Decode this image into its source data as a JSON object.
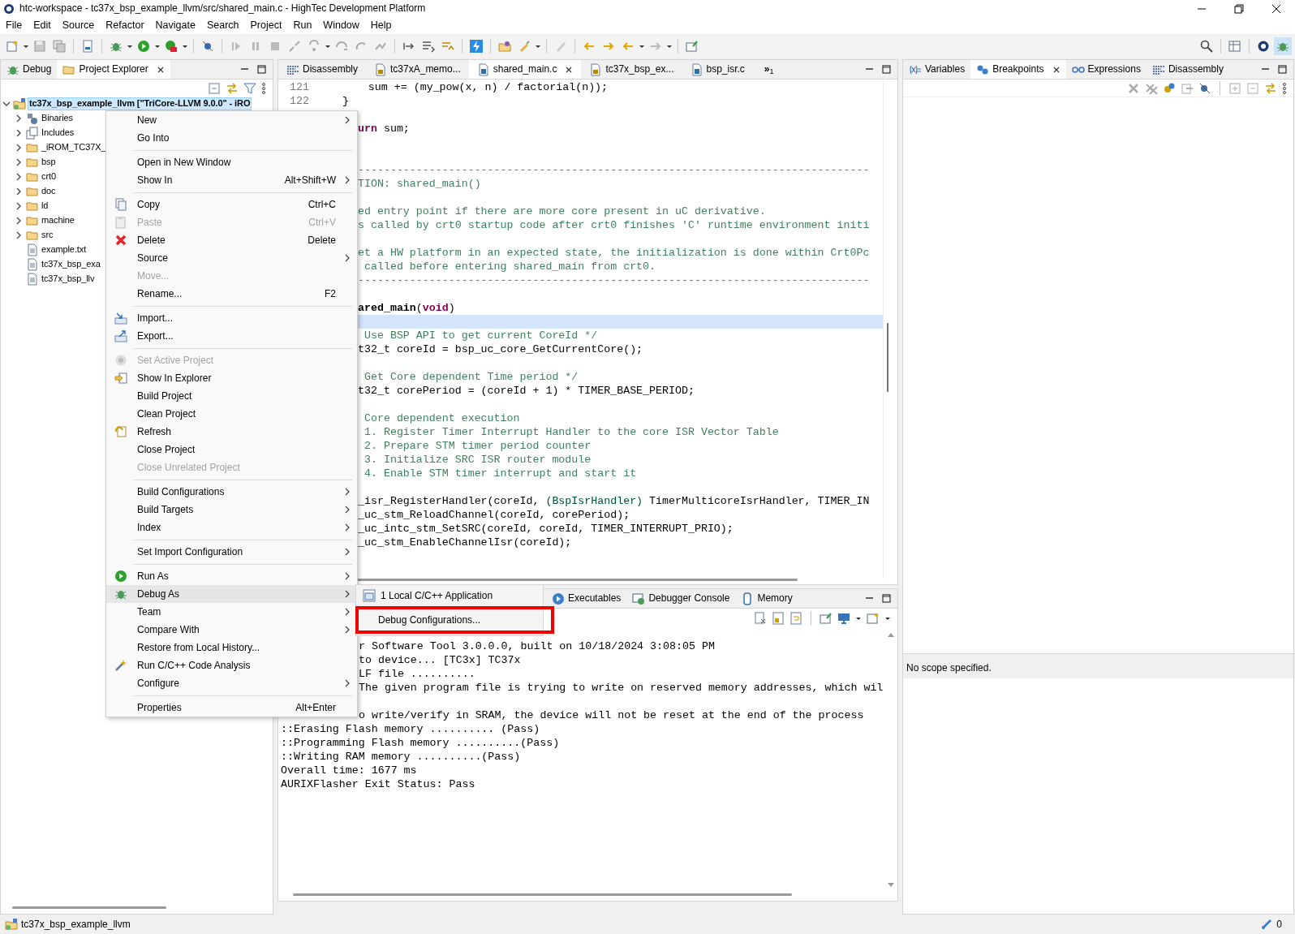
{
  "window": {
    "title": "htc-workspace - tc37x_bsp_example_llvm/src/shared_main.c - HighTec Development Platform"
  },
  "menu_bar": [
    "File",
    "Edit",
    "Source",
    "Refactor",
    "Navigate",
    "Search",
    "Project",
    "Run",
    "Window",
    "Help"
  ],
  "left_panel": {
    "tabs": [
      {
        "label": "Debug",
        "selected": false,
        "closable": false
      },
      {
        "label": "Project Explorer",
        "selected": true,
        "closable": true
      }
    ],
    "tree": [
      {
        "label": "tc37x_bsp_example_llvm [\"TriCore-LLVM 9.0.0\" - iRO",
        "kind": "project",
        "expanded": true,
        "selected": true,
        "children": [
          {
            "label": "Binaries",
            "kind": "binaries",
            "expanded": false,
            "selected": false
          },
          {
            "label": "Includes",
            "kind": "includes",
            "expanded": false,
            "selected": false
          },
          {
            "label": "_iROM_TC37X_",
            "kind": "folder",
            "expanded": false,
            "selected": false
          },
          {
            "label": "bsp",
            "kind": "folder",
            "expanded": false,
            "selected": false
          },
          {
            "label": "crt0",
            "kind": "folder",
            "expanded": false,
            "selected": false
          },
          {
            "label": "doc",
            "kind": "folder",
            "expanded": false,
            "selected": false
          },
          {
            "label": "ld",
            "kind": "folder",
            "expanded": false,
            "selected": false
          },
          {
            "label": "machine",
            "kind": "folder",
            "expanded": false,
            "selected": false
          },
          {
            "label": "src",
            "kind": "folder",
            "expanded": false,
            "selected": false
          },
          {
            "label": "example.txt",
            "kind": "file",
            "selected": false
          },
          {
            "label": "tc37x_bsp_exa",
            "kind": "file",
            "selected": false
          },
          {
            "label": "tc37x_bsp_llv",
            "kind": "file",
            "selected": false
          }
        ]
      }
    ]
  },
  "editor": {
    "tabs": [
      {
        "label": "Disassembly",
        "kind": "disassembly",
        "selected": false,
        "closable": false
      },
      {
        "label": "tc37xA_memo...",
        "kind": "ld",
        "selected": false,
        "closable": false
      },
      {
        "label": "shared_main.c",
        "kind": "c",
        "selected": true,
        "closable": true
      },
      {
        "label": "tc37x_bsp_ex...",
        "kind": "ld",
        "selected": false,
        "closable": false
      },
      {
        "label": "bsp_isr.c",
        "kind": "c",
        "selected": false,
        "closable": false
      }
    ],
    "overflow": {
      "mark": "»",
      "count": "1"
    },
    "lines": [
      {
        "kind": "numbered",
        "number": "121",
        "current": false,
        "parts": [
          {
            "kind": "plain",
            "text": "        sum += (my_pow(x, n) / factorial(n));"
          }
        ]
      },
      {
        "kind": "numbered",
        "number": "122",
        "current": false,
        "parts": [
          {
            "kind": "plain",
            "text": "    }"
          }
        ]
      },
      {
        "kind": "blank",
        "current": false
      },
      {
        "kind": "clipped",
        "current": false,
        "parts": [
          {
            "kind": "keyword",
            "text": "urn"
          },
          {
            "kind": "plain",
            "text": " sum;"
          }
        ]
      },
      {
        "kind": "blank",
        "current": false
      },
      {
        "kind": "blank",
        "current": false
      },
      {
        "kind": "clipped",
        "current": false,
        "parts": [
          {
            "kind": "comment",
            "text": "-------------------------------------------------------------------------------"
          }
        ]
      },
      {
        "kind": "clipped",
        "current": false,
        "parts": [
          {
            "kind": "comment",
            "text": "TION: shared_main()"
          }
        ]
      },
      {
        "kind": "blank",
        "current": false
      },
      {
        "kind": "clipped",
        "current": false,
        "parts": [
          {
            "kind": "comment",
            "text": "ed entry point if there are more core present in uC derivative."
          }
        ]
      },
      {
        "kind": "clipped",
        "current": false,
        "parts": [
          {
            "kind": "comment",
            "text": "s called by crt0 startup code after crt0 finishes 'C' runtime environment initi"
          }
        ]
      },
      {
        "kind": "blank",
        "current": false
      },
      {
        "kind": "clipped",
        "current": false,
        "parts": [
          {
            "kind": "comment",
            "text": "et a HW platform in an expected state, the initialization is done within Crt0Pc"
          }
        ]
      },
      {
        "kind": "clipped",
        "current": false,
        "parts": [
          {
            "kind": "comment",
            "text": " called before entering shared_main from crt0."
          }
        ]
      },
      {
        "kind": "clipped",
        "current": false,
        "parts": [
          {
            "kind": "comment",
            "text": "-------------------------------------------------------------------------------"
          }
        ]
      },
      {
        "kind": "blank",
        "current": false
      },
      {
        "kind": "clipped",
        "current": false,
        "parts": [
          {
            "kind": "bold",
            "text": "ared_main"
          },
          {
            "kind": "plain",
            "text": "("
          },
          {
            "kind": "keyword",
            "text": "void"
          },
          {
            "kind": "plain",
            "text": ")"
          }
        ]
      },
      {
        "kind": "blank",
        "current": true
      },
      {
        "kind": "clipped",
        "current": false,
        "parts": [
          {
            "kind": "comment",
            "text": " Use BSP API to get current CoreId */"
          }
        ]
      },
      {
        "kind": "clipped",
        "current": false,
        "parts": [
          {
            "kind": "plain",
            "text": "t32_t coreId = bsp_uc_core_GetCurrentCore();"
          }
        ]
      },
      {
        "kind": "blank",
        "current": false
      },
      {
        "kind": "clipped",
        "current": false,
        "parts": [
          {
            "kind": "comment",
            "text": " Get Core dependent Time period */"
          }
        ]
      },
      {
        "kind": "clipped",
        "current": false,
        "parts": [
          {
            "kind": "plain",
            "text": "t32_t corePeriod = (coreId + 1) * TIMER_BASE_PERIOD;"
          }
        ]
      },
      {
        "kind": "blank",
        "current": false
      },
      {
        "kind": "clipped",
        "current": false,
        "parts": [
          {
            "kind": "comment",
            "text": " Core dependent execution"
          }
        ]
      },
      {
        "kind": "clipped",
        "current": false,
        "parts": [
          {
            "kind": "comment",
            "text": " 1. Register Timer Interrupt Handler to the core ISR Vector Table"
          }
        ]
      },
      {
        "kind": "clipped",
        "current": false,
        "parts": [
          {
            "kind": "comment",
            "text": " 2. Prepare STM timer period counter"
          }
        ]
      },
      {
        "kind": "clipped",
        "current": false,
        "parts": [
          {
            "kind": "comment",
            "text": " 3. Initialize SRC ISR router module"
          }
        ]
      },
      {
        "kind": "clipped",
        "current": false,
        "parts": [
          {
            "kind": "comment",
            "text": " 4. Enable STM timer interrupt and start it"
          }
        ]
      },
      {
        "kind": "blank",
        "current": false
      },
      {
        "kind": "clipped",
        "current": false,
        "parts": [
          {
            "kind": "plain",
            "text": "_isr_RegisterHandler(coreId, "
          },
          {
            "kind": "type",
            "text": "(BspIsrHandler)"
          },
          {
            "kind": "plain",
            "text": " TimerMulticoreIsrHandler, TIMER_IN"
          }
        ]
      },
      {
        "kind": "clipped",
        "current": false,
        "parts": [
          {
            "kind": "plain",
            "text": "_uc_stm_ReloadChannel(coreId, corePeriod);"
          }
        ]
      },
      {
        "kind": "clipped",
        "current": false,
        "parts": [
          {
            "kind": "plain",
            "text": "_uc_intc_stm_SetSRC(coreId, coreId, TIMER_INTERRUPT_PRIO);"
          }
        ]
      },
      {
        "kind": "clipped",
        "current": false,
        "parts": [
          {
            "kind": "plain",
            "text": "_uc_stm_EnableChannelIsr(coreId);"
          }
        ]
      }
    ]
  },
  "context_menu": {
    "groups": [
      [
        {
          "label": "New",
          "submenu": true,
          "disabled": false,
          "selected": false
        },
        {
          "label": "Go Into",
          "submenu": false,
          "disabled": false,
          "selected": false
        }
      ],
      [
        {
          "label": "Open in New Window",
          "submenu": false,
          "disabled": false,
          "selected": false
        },
        {
          "label": "Show In",
          "shortcut": "Alt+Shift+W",
          "submenu": true,
          "disabled": false,
          "selected": false
        }
      ],
      [
        {
          "label": "Copy",
          "shortcut": "Ctrl+C",
          "submenu": false,
          "disabled": false,
          "selected": false
        },
        {
          "label": "Paste",
          "shortcut": "Ctrl+V",
          "submenu": false,
          "disabled": true,
          "selected": false
        },
        {
          "label": "Delete",
          "shortcut": "Delete",
          "submenu": false,
          "disabled": false,
          "selected": false
        },
        {
          "label": "Source",
          "submenu": true,
          "disabled": false,
          "selected": false
        },
        {
          "label": "Move...",
          "submenu": false,
          "disabled": true,
          "selected": false
        },
        {
          "label": "Rename...",
          "shortcut": "F2",
          "submenu": false,
          "disabled": false,
          "selected": false
        }
      ],
      [
        {
          "label": "Import...",
          "submenu": false,
          "disabled": false,
          "selected": false
        },
        {
          "label": "Export...",
          "submenu": false,
          "disabled": false,
          "selected": false
        }
      ],
      [
        {
          "label": "Set Active Project",
          "submenu": false,
          "disabled": true,
          "selected": false
        },
        {
          "label": "Show In Explorer",
          "submenu": false,
          "disabled": false,
          "selected": false
        },
        {
          "label": "Build Project",
          "submenu": false,
          "disabled": false,
          "selected": false
        },
        {
          "label": "Clean Project",
          "submenu": false,
          "disabled": false,
          "selected": false
        },
        {
          "label": "Refresh",
          "submenu": false,
          "disabled": false,
          "selected": false
        },
        {
          "label": "Close Project",
          "submenu": false,
          "disabled": false,
          "selected": false
        },
        {
          "label": "Close Unrelated Project",
          "submenu": false,
          "disabled": true,
          "selected": false
        }
      ],
      [
        {
          "label": "Build Configurations",
          "submenu": true,
          "disabled": false,
          "selected": false
        },
        {
          "label": "Build Targets",
          "submenu": true,
          "disabled": false,
          "selected": false
        },
        {
          "label": "Index",
          "submenu": true,
          "disabled": false,
          "selected": false
        }
      ],
      [
        {
          "label": "Set Import Configuration",
          "submenu": true,
          "disabled": false,
          "selected": false
        }
      ],
      [
        {
          "label": "Run As",
          "submenu": true,
          "disabled": false,
          "selected": false
        },
        {
          "label": "Debug As",
          "submenu": true,
          "disabled": false,
          "selected": true
        },
        {
          "label": "Team",
          "submenu": true,
          "disabled": false,
          "selected": false
        },
        {
          "label": "Compare With",
          "submenu": true,
          "disabled": false,
          "selected": false
        },
        {
          "label": "Restore from Local History...",
          "submenu": false,
          "disabled": false,
          "selected": false
        },
        {
          "label": "Run C/C++ Code Analysis",
          "submenu": false,
          "disabled": false,
          "selected": false
        },
        {
          "label": "Configure",
          "submenu": true,
          "disabled": false,
          "selected": false
        }
      ],
      [
        {
          "label": "Properties",
          "shortcut": "Alt+Enter",
          "submenu": false,
          "disabled": false,
          "selected": false
        }
      ]
    ]
  },
  "submenu": {
    "items": [
      {
        "label": "1 Local C/C++ Application",
        "outlined": false
      },
      {
        "label": "Debug Configurations...",
        "outlined": true
      }
    ]
  },
  "console": {
    "tabs": [
      {
        "label": "Executables",
        "selected": false
      },
      {
        "label": "Debugger Console",
        "selected": false
      },
      {
        "label": "Memory",
        "selected": false
      }
    ],
    "lines": [
      {
        "kind": "clipped",
        "text": "r Software Tool 3.0.0.0, built on 10/18/2024 3:08:05 PM"
      },
      {
        "kind": "clipped",
        "text": "to device... [TC3x] TC37x"
      },
      {
        "kind": "clipped",
        "text": "LF file .........."
      },
      {
        "kind": "clipped",
        "text": "The given program file is trying to write on reserved memory addresses, which wil"
      },
      {
        "kind": "blank"
      },
      {
        "kind": "clipped",
        "text": "o write/verify in SRAM, the device will not be reset at the end of the process"
      },
      {
        "kind": "full",
        "text": "::Erasing Flash memory .......... (Pass)"
      },
      {
        "kind": "full",
        "text": "::Programming Flash memory ..........(Pass)"
      },
      {
        "kind": "full",
        "text": "::Writing RAM memory ..........(Pass)"
      },
      {
        "kind": "full",
        "text": "Overall time: 1677 ms"
      },
      {
        "kind": "full",
        "text": "AURIXFlasher Exit Status: Pass"
      }
    ]
  },
  "right_panel": {
    "tabs": [
      {
        "label": "Variables",
        "selected": false,
        "closable": false
      },
      {
        "label": "Breakpoints",
        "selected": true,
        "closable": true
      },
      {
        "label": "Expressions",
        "selected": false,
        "closable": false
      },
      {
        "label": "Disassembly",
        "selected": false,
        "closable": false
      }
    ],
    "message": "No scope specified."
  },
  "status_bar": {
    "selection": "tc37x_bsp_example_llvm",
    "count": "0"
  }
}
